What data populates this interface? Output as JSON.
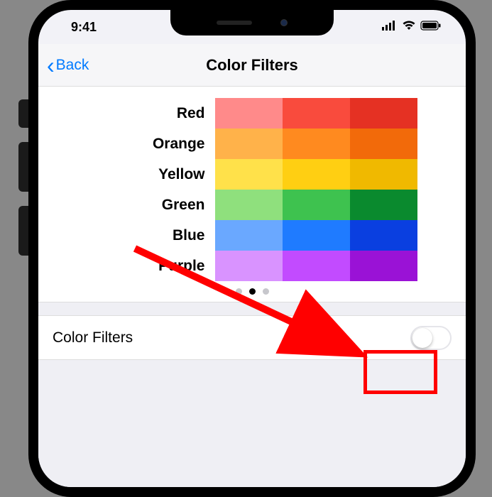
{
  "status": {
    "time": "9:41"
  },
  "nav": {
    "back": "Back",
    "title": "Color Filters"
  },
  "colors": {
    "rows": [
      {
        "label": "Red",
        "swatches": [
          "#ff8a8a",
          "#f94b3d",
          "#e53123"
        ]
      },
      {
        "label": "Orange",
        "swatches": [
          "#ffb24a",
          "#ff8a1f",
          "#f26a0a"
        ]
      },
      {
        "label": "Yellow",
        "swatches": [
          "#ffe14a",
          "#ffcf12",
          "#f0b900"
        ]
      },
      {
        "label": "Green",
        "swatches": [
          "#8fe07d",
          "#3ec24f",
          "#0a8a2e"
        ]
      },
      {
        "label": "Blue",
        "swatches": [
          "#6aa8ff",
          "#1f7bff",
          "#0a3fe0"
        ]
      },
      {
        "label": "Purple",
        "swatches": [
          "#d993ff",
          "#c24bff",
          "#9a12d6"
        ]
      }
    ],
    "page_index": 1,
    "page_count": 3
  },
  "setting": {
    "label": "Color Filters",
    "enabled": false
  }
}
